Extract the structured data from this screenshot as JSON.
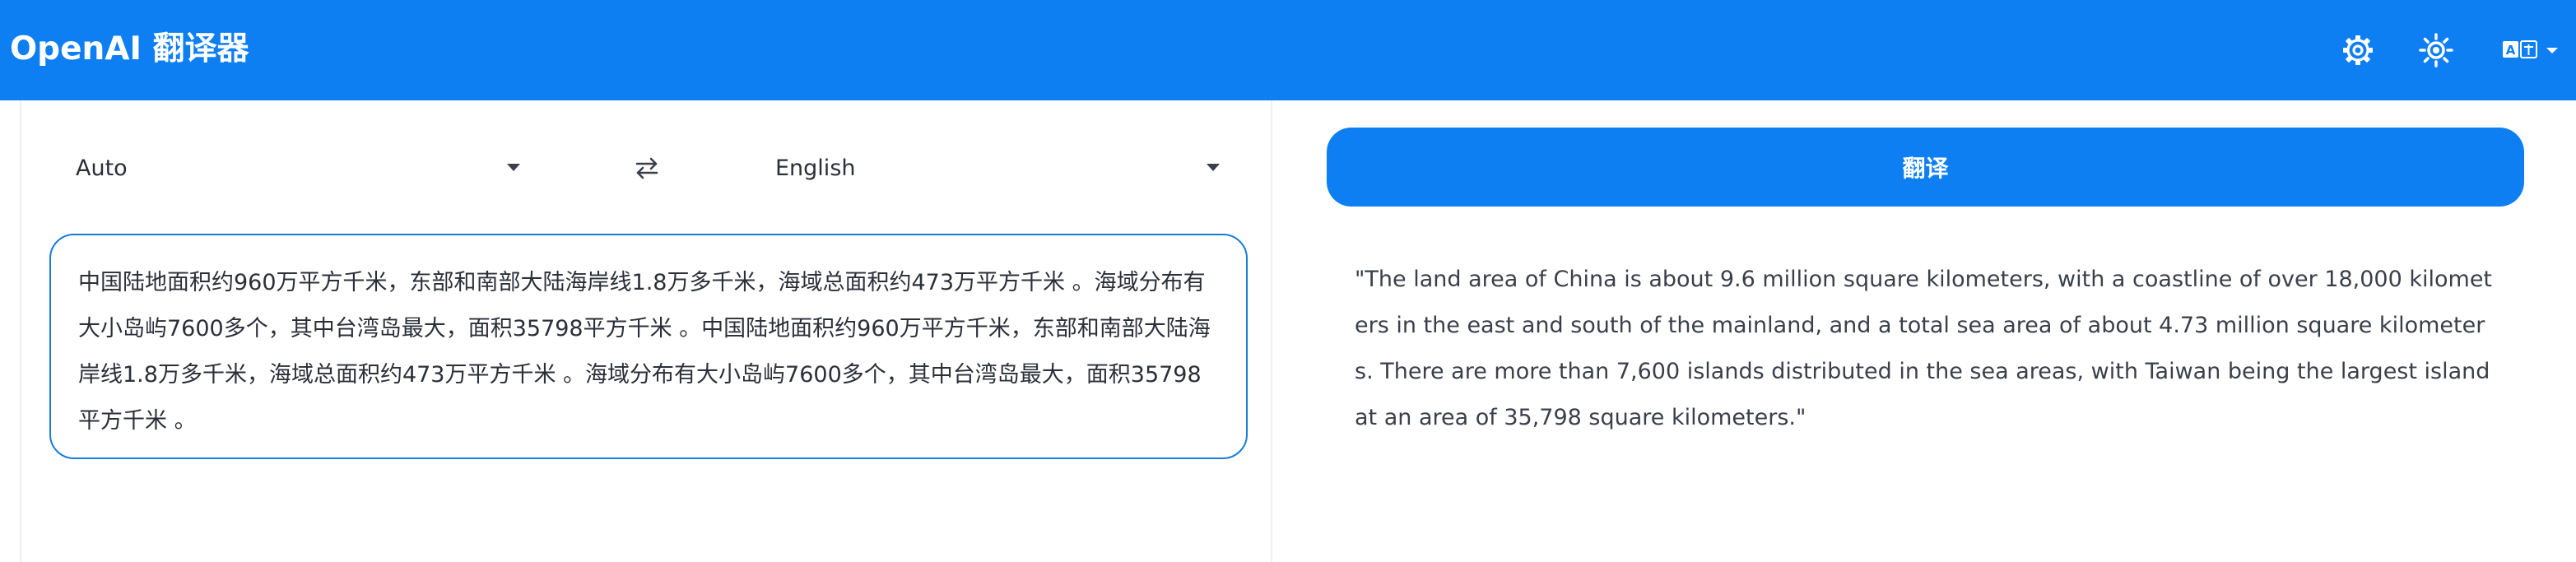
{
  "header": {
    "title": "OpenAI 翻译器",
    "icons": [
      "settings-gear-icon",
      "theme-sun-icon",
      "language-switch-icon",
      "chevron-down-icon"
    ]
  },
  "languages": {
    "source": "Auto",
    "target": "English",
    "swap_icon": "swap-arrows-icon"
  },
  "source_text": "中国陆地面积约960万平方千米，东部和南部大陆海岸线1.8万多千米，海域总面积约473万平方千米 。海域分布有大小岛屿7600多个，其中台湾岛最大，面积35798平方千米 。中国陆地面积约960万平方千米，东部和南部大陆海岸线1.8万多千米，海域总面积约473万平方千米 。海域分布有大小岛屿7600多个，其中台湾岛最大，面积35798平方千米 。",
  "translate_button": "翻译",
  "result_text": "\"The land area of China is about 9.6 million square kilometers, with a coastline of over 18,000 kilometers in the east and south of the mainland, and a total sea area of about 4.73 million square kilometers. There are more than 7,600 islands distributed in the sea areas, with Taiwan being the largest island at an area of 35,798 square kilometers.\"",
  "colors": {
    "primary": "#0d7ff2",
    "border": "#1a7bd8",
    "text": "#2b2f38"
  }
}
